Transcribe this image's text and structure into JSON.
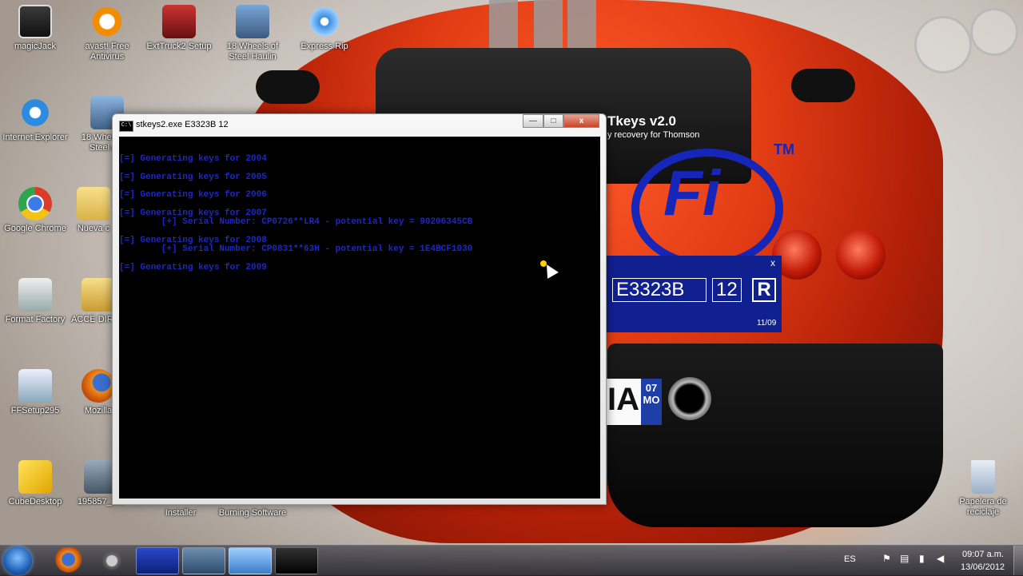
{
  "desktop_icons": [
    {
      "label": "magicJack"
    },
    {
      "label": "avast! Free Antivirus"
    },
    {
      "label": "ExtTruck2 Setup"
    },
    {
      "label": "18 Wheels of Steel Haulin"
    },
    {
      "label": "Express Rip"
    },
    {
      "label": "Internet Explorer"
    },
    {
      "label": "18 Wheels of Steel Am"
    },
    {
      "label": "Google Chrome"
    },
    {
      "label": "Nueva c"
    },
    {
      "label": "Format Factory"
    },
    {
      "label": "ACCE DIREC"
    },
    {
      "label": "FFSetup295"
    },
    {
      "label": "Mozilla"
    },
    {
      "label": "CubeDesktop"
    },
    {
      "label": "195857_1..."
    },
    {
      "label": "Installer"
    },
    {
      "label": "Burning Software"
    },
    {
      "label": "Papelera de reciclaje"
    }
  ],
  "wifi_app": {
    "title": "Tkeys v2.0",
    "subtitle": "y recovery for Thomson",
    "logo": "Fi",
    "tm": "TM",
    "close": "x",
    "ssid_value": "E3323B",
    "year_value": "12",
    "run_button": "R",
    "date": "11/09"
  },
  "console": {
    "title": "stkeys2.exe  E3323B 12",
    "icon_text": "C:\\",
    "minimize": "—",
    "maximize": "□",
    "close": "x",
    "lines": [
      "[=] Generating keys for 2004",
      "[=] Generating keys for 2005",
      "[=] Generating keys for 2006",
      "[=] Generating keys for 2007",
      "        [+] Serial Number: CP0726**LR4 - potential key = 90206345CB",
      "[=] Generating keys for 2008",
      "        [+] Serial Number: CP0831**63H - potential key = 1E4BCF1030",
      "[=] Generating keys for 2009"
    ]
  },
  "taskbar": {
    "language": "ES",
    "time": "09:07 a.m.",
    "date": "13/06/2012"
  }
}
